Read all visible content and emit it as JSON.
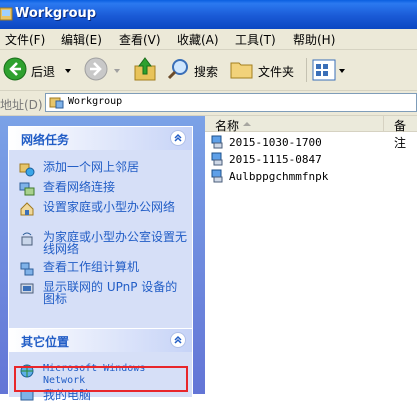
{
  "title": "Workgroup",
  "menu": [
    "文件(F)",
    "编辑(E)",
    "查看(V)",
    "收藏(A)",
    "工具(T)",
    "帮助(H)"
  ],
  "toolbar": {
    "back": "后退",
    "search": "搜索",
    "folders": "文件夹"
  },
  "address": {
    "label": "地址(D)",
    "value": "Workgroup"
  },
  "network_tasks": {
    "title": "网络任务",
    "items": [
      {
        "label": "添加一个网上邻居",
        "icon": "add-network-place-icon"
      },
      {
        "label": "查看网络连接",
        "icon": "network-connections-icon"
      },
      {
        "label": "设置家庭或小型办公网络",
        "icon": "home-network-icon"
      },
      {
        "label": "为家庭或小型办公室设置无线网络",
        "icon": "wireless-network-icon"
      },
      {
        "label": "查看工作组计算机",
        "icon": "workgroup-computers-icon"
      },
      {
        "label": "显示联网的 UPnP 设备的图标",
        "icon": "upnp-device-icon"
      }
    ]
  },
  "other_places": {
    "title": "其它位置",
    "items": [
      {
        "label": "Microsoft Windows Network",
        "icon": "windows-network-icon"
      },
      {
        "label": "我的电脑",
        "icon": "my-computer-icon"
      }
    ]
  },
  "columns": [
    "名称",
    "备注"
  ],
  "files": [
    {
      "name": "2015-1030-1700",
      "icon": "computer-icon"
    },
    {
      "name": "2015-1115-0847",
      "icon": "computer-icon"
    },
    {
      "name": "Aulbppgchmmfnpk",
      "icon": "computer-icon"
    }
  ],
  "colors": {
    "title_bar": "#0b47c2",
    "task_link": "#215dc6",
    "highlight_border": "#e8262b"
  }
}
